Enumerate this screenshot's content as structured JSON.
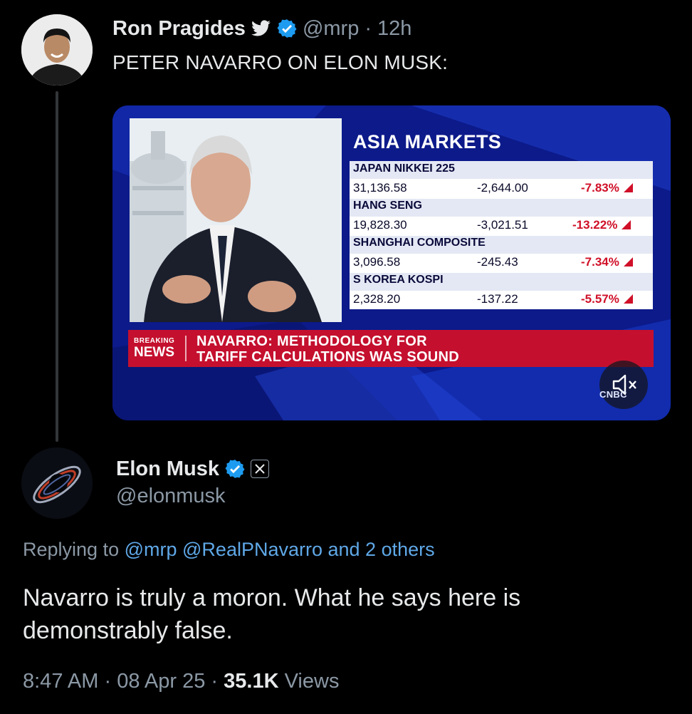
{
  "original_tweet": {
    "author_name": "Ron Pragides",
    "handle": "@mrp",
    "separator": "·",
    "time": "12h",
    "text": "PETER NAVARRO ON ELON MUSK:"
  },
  "video": {
    "board_title": "ASIA MARKETS",
    "markets": [
      {
        "name": "JAPAN NIKKEI 225",
        "value": "31,136.58",
        "change": "-2,644.00",
        "percent": "-7.83%"
      },
      {
        "name": "HANG SENG",
        "value": "19,828.30",
        "change": "-3,021.51",
        "percent": "-13.22%"
      },
      {
        "name": "SHANGHAI COMPOSITE",
        "value": "3,096.58",
        "change": "-245.43",
        "percent": "-7.34%"
      },
      {
        "name": "S KOREA KOSPI",
        "value": "2,328.20",
        "change": "-137.22",
        "percent": "-5.57%"
      }
    ],
    "breaking_label": "BREAKING",
    "news_label": "NEWS",
    "headline_line1": "NAVARRO: METHODOLOGY FOR",
    "headline_line2": "TARIFF CALCULATIONS WAS SOUND",
    "network_logo": "CNBC",
    "mute_icon": "speaker-muted-icon"
  },
  "reply": {
    "author_name": "Elon Musk",
    "handle": "@elonmusk",
    "replying_prefix": "Replying to",
    "replying_to": "@mrp @RealPNavarro and 2 others",
    "text": "Navarro is truly a moron. What he says here is demonstrably false.",
    "time": "8:47 AM",
    "date": "08 Apr 25",
    "sep": "·",
    "views_count": "35.1K",
    "views_label": "Views"
  },
  "colors": {
    "background": "#000000",
    "text_primary": "#e7e9ea",
    "text_secondary": "#8b98a5",
    "link": "#5fa8e8",
    "verified": "#1d9bf0",
    "ticker_red": "#c4102e",
    "cnbc_blue": "#0c1a8a"
  }
}
